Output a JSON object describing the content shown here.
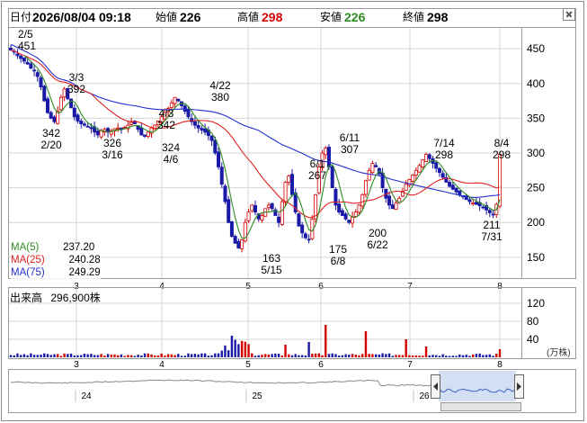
{
  "header": {
    "date_label": "日付",
    "date_value": "2026/08/04 09:18",
    "open_label": "始値",
    "open_value": "226",
    "high_label": "高値",
    "high_value": "298",
    "low_label": "安値",
    "low_value": "226",
    "close_label": "終値",
    "close_value": "298"
  },
  "colors": {
    "up": "#d40000",
    "down": "#1a1aa8",
    "ma5": "#2e8b22",
    "ma25": "#e02020",
    "ma75": "#2030d0",
    "high_value": "#d40000",
    "low_value": "#2e8b22",
    "grid": "#d6d6d6"
  },
  "ma_legend": [
    {
      "label": "MA(5)",
      "value": "237.20",
      "color": "#2e8b22"
    },
    {
      "label": "MA(25)",
      "value": "240.28",
      "color": "#e02020"
    },
    {
      "label": "MA(75)",
      "value": "249.29",
      "color": "#2030d0"
    }
  ],
  "volume_label": "出来高",
  "volume_value": "296,900株",
  "volume_unit": "(万株)",
  "chart_data": [
    {
      "type": "candlestick",
      "title": "",
      "ylim": [
        120,
        480
      ],
      "yticks": [
        150,
        200,
        250,
        300,
        350,
        400,
        450
      ],
      "month_ticks": [
        "3",
        "4",
        "5",
        "6",
        "7",
        "8"
      ],
      "annotations": [
        {
          "value": "451",
          "date": "2/5"
        },
        {
          "value": "392",
          "date": "3/3"
        },
        {
          "value": "342",
          "date": "2/20"
        },
        {
          "value": "326",
          "date": "3/16"
        },
        {
          "value": "342",
          "date": "4/3"
        },
        {
          "value": "324",
          "date": "4/6"
        },
        {
          "value": "380",
          "date": "4/22"
        },
        {
          "value": "307",
          "date": "6/11"
        },
        {
          "value": "267",
          "date": "6/1"
        },
        {
          "value": "163",
          "date": "5/15"
        },
        {
          "value": "175",
          "date": "6/8"
        },
        {
          "value": "200",
          "date": "6/22"
        },
        {
          "value": "298",
          "date": "7/14"
        },
        {
          "value": "298",
          "date": "8/4"
        },
        {
          "value": "211",
          "date": "7/31"
        }
      ],
      "closes_approx": [
        448,
        445,
        440,
        436,
        432,
        428,
        422,
        418,
        410,
        395,
        375,
        358,
        350,
        345,
        360,
        380,
        392,
        378,
        365,
        352,
        346,
        342,
        340,
        338,
        335,
        330,
        326,
        332,
        334,
        330,
        332,
        335,
        336,
        334,
        337,
        340,
        344,
        342,
        334,
        326,
        324,
        330,
        336,
        340,
        346,
        352,
        358,
        364,
        372,
        380,
        375,
        368,
        360,
        352,
        345,
        340,
        336,
        333,
        330,
        325,
        318,
        300,
        280,
        255,
        230,
        200,
        180,
        170,
        163,
        175,
        200,
        215,
        225,
        215,
        205,
        210,
        220,
        225,
        220,
        210,
        200,
        230,
        258,
        267,
        240,
        215,
        195,
        185,
        178,
        175,
        205,
        240,
        280,
        300,
        307,
        280,
        250,
        225,
        215,
        210,
        205,
        200,
        208,
        215,
        225,
        240,
        260,
        275,
        285,
        280,
        270,
        250,
        235,
        225,
        220,
        228,
        235,
        245,
        255,
        262,
        268,
        275,
        282,
        290,
        298,
        292,
        285,
        278,
        272,
        265,
        258,
        252,
        248,
        244,
        240,
        237,
        233,
        230,
        228,
        226,
        224,
        222,
        218,
        214,
        211,
        226,
        298
      ]
    },
    {
      "type": "bar",
      "title": "",
      "yticks": [
        40,
        80,
        120
      ],
      "ylim": [
        0,
        140
      ]
    }
  ],
  "navigator": {
    "labels": [
      "24",
      "25",
      "26"
    ]
  }
}
